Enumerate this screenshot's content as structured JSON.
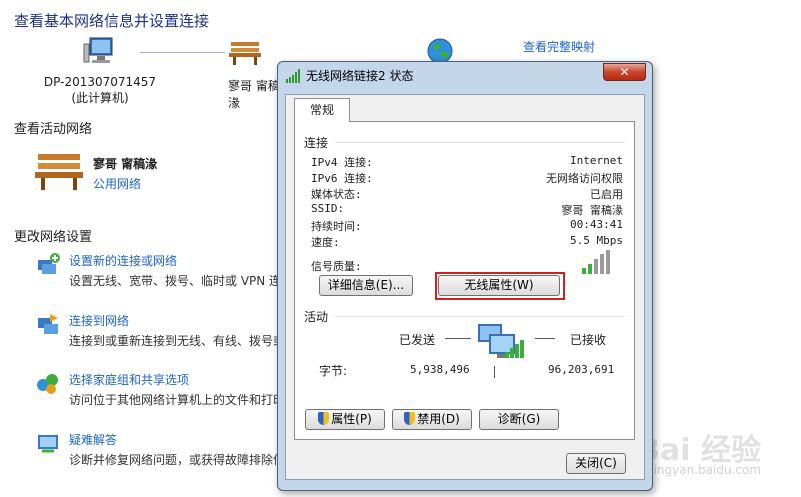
{
  "background": {
    "title": "查看基本网络信息并设置连接",
    "full_map_link": "查看完整映射",
    "computer": {
      "name": "DP-201307071457",
      "sub": "(此计算机)"
    },
    "network_node": {
      "name": "寥哥 甯稿湪"
    },
    "active_section": "查看活动网络",
    "active_network": {
      "name": "寥哥 甯稿湪",
      "type": "公用网络"
    },
    "change_section": "更改网络设置",
    "tasks": [
      {
        "link": "设置新的连接或网络",
        "desc": "设置无线、宽带、拨号、临时或 VPN 连"
      },
      {
        "link": "连接到网络",
        "desc": "连接到或重新连接到无线、有线、拨号或"
      },
      {
        "link": "选择家庭组和共享选项",
        "desc": "访问位于其他网络计算机上的文件和打印"
      },
      {
        "link": "疑难解答",
        "desc": "诊断并修复网络问题，或获得故障排除信"
      }
    ]
  },
  "dialog": {
    "title": "无线网络链接2 状态",
    "close_label": "✕",
    "tab": "常规",
    "connection_group": "连接",
    "rows": [
      {
        "label": "IPv4 连接:",
        "value": "Internet"
      },
      {
        "label": "IPv6 连接:",
        "value": "无网络访问权限"
      },
      {
        "label": "媒体状态:",
        "value": "已启用"
      },
      {
        "label": "SSID:",
        "value": "寥哥 甯稿湪"
      },
      {
        "label": "持续时间:",
        "value": "00:43:41"
      },
      {
        "label": "速度:",
        "value": "5.5 Mbps"
      }
    ],
    "signal_label": "信号质量:",
    "details_button": "详细信息(E)...",
    "wireless_props_button": "无线属性(W)",
    "activity_group": "活动",
    "sent_label": "已发送",
    "received_label": "已接收",
    "bytes_label": "字节:",
    "bytes_sent": "5,938,496",
    "bytes_received": "96,203,691",
    "properties_button": "属性(P)",
    "disable_button": "禁用(D)",
    "diagnose_button": "诊断(G)",
    "close_button": "关闭(C)"
  },
  "watermark": {
    "brand": "Bai 经验",
    "url": "jingyan.baidu.com"
  }
}
